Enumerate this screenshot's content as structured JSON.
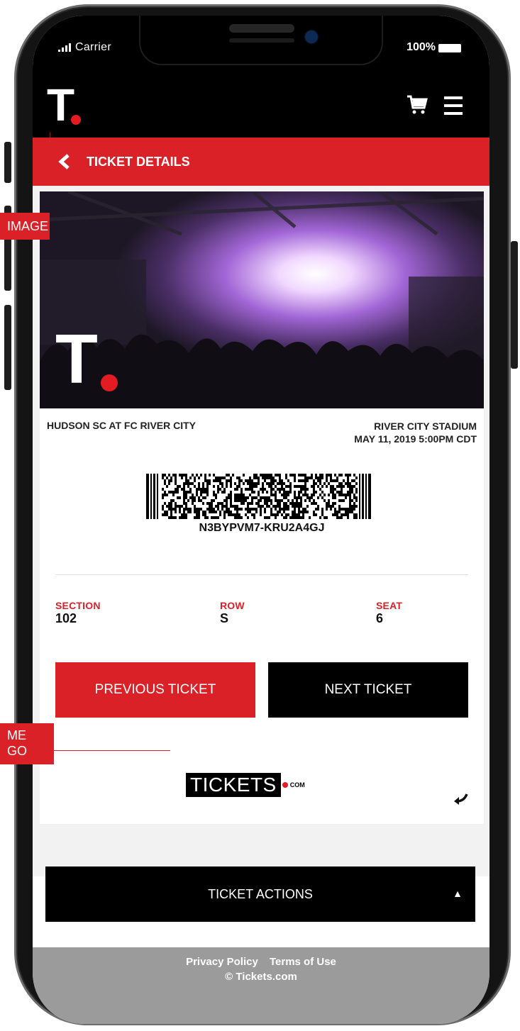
{
  "status_bar": {
    "carrier": "Carrier",
    "battery": "100%"
  },
  "header": {
    "logo": "T."
  },
  "title_bar": {
    "back_icon": "chevron-left",
    "title": "TICKET DETAILS"
  },
  "ticket": {
    "event": "HUDSON SC AT FC RIVER CITY",
    "venue": "RIVER CITY STADIUM",
    "datetime": "MAY 11, 2019 5:00PM CDT",
    "barcode_text": "N3BYPVM7-KRU2A4GJ",
    "hero_logo": "T.",
    "section_label": "SECTION",
    "section_value": "102",
    "row_label": "ROW",
    "row_value": "S",
    "seat_label": "SEAT",
    "seat_value": "6"
  },
  "buttons": {
    "previous": "PREVIOUS TICKET",
    "next": "NEXT TICKET"
  },
  "brand": {
    "name": "TICKETS",
    "suffix": "COM"
  },
  "actions": {
    "label": "TICKET ACTIONS"
  },
  "footer": {
    "privacy": "Privacy Policy",
    "terms": "Terms of Use",
    "copyright": "© Tickets.com"
  },
  "annotations": {
    "image_tag": "IMAGE",
    "logo_tag_line1": "ME",
    "logo_tag_line2": "GO"
  },
  "colors": {
    "accent": "#da2128",
    "dark": "#000000",
    "footer": "#9b9b9b"
  }
}
